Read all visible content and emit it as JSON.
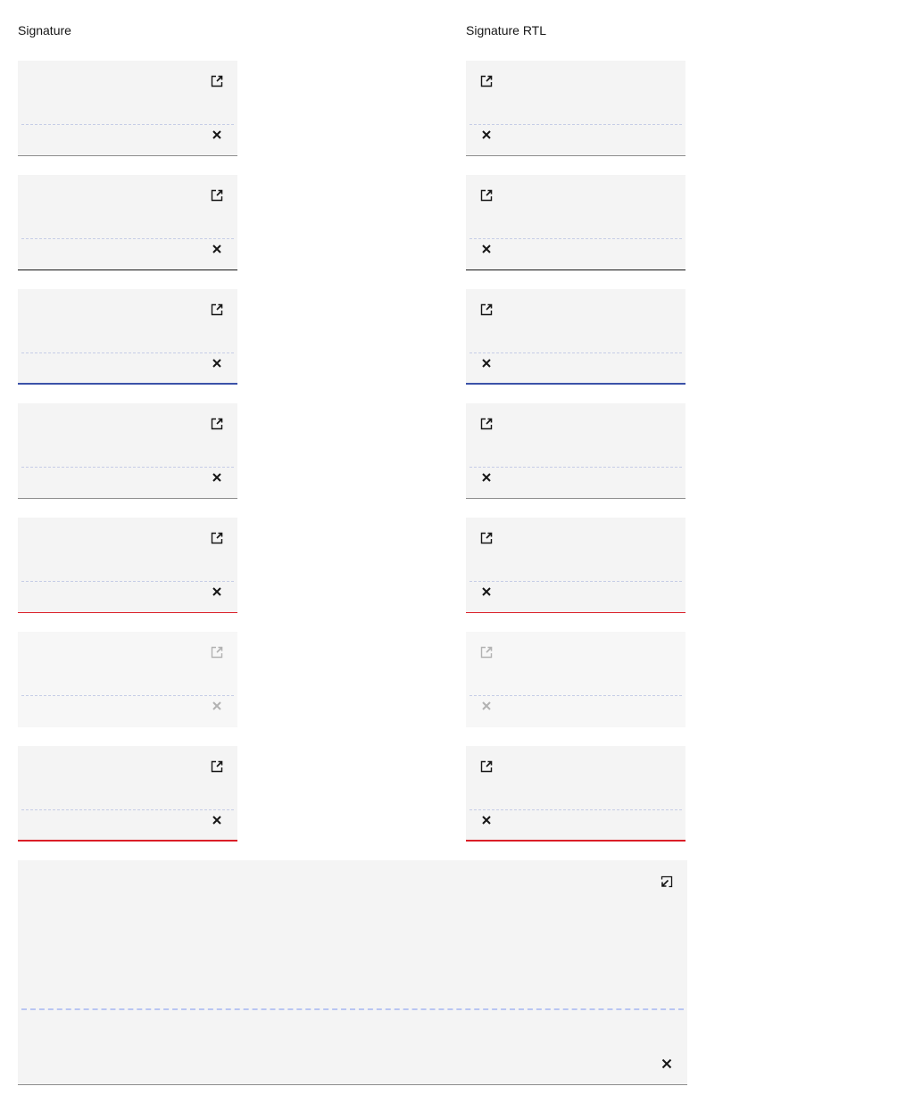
{
  "headings": {
    "ltr": "Signature",
    "rtl": "Signature RTL"
  },
  "icons": {
    "expand": "launch-icon",
    "clear": "close-icon",
    "collapse": "minimize-icon"
  },
  "colors": {
    "field_background": "#f4f4f4",
    "baseline_dash": "#c6cde6",
    "focus_underline": "#3b52a8",
    "invalid_underline": "#da1e28",
    "default_underline": "#8d8d8d",
    "hover_underline": "#161616"
  },
  "variants": [
    "default",
    "hover",
    "focus",
    "default",
    "invalid",
    "disabled",
    "invalid-focus"
  ],
  "expanded_field": {
    "state": "expanded"
  }
}
